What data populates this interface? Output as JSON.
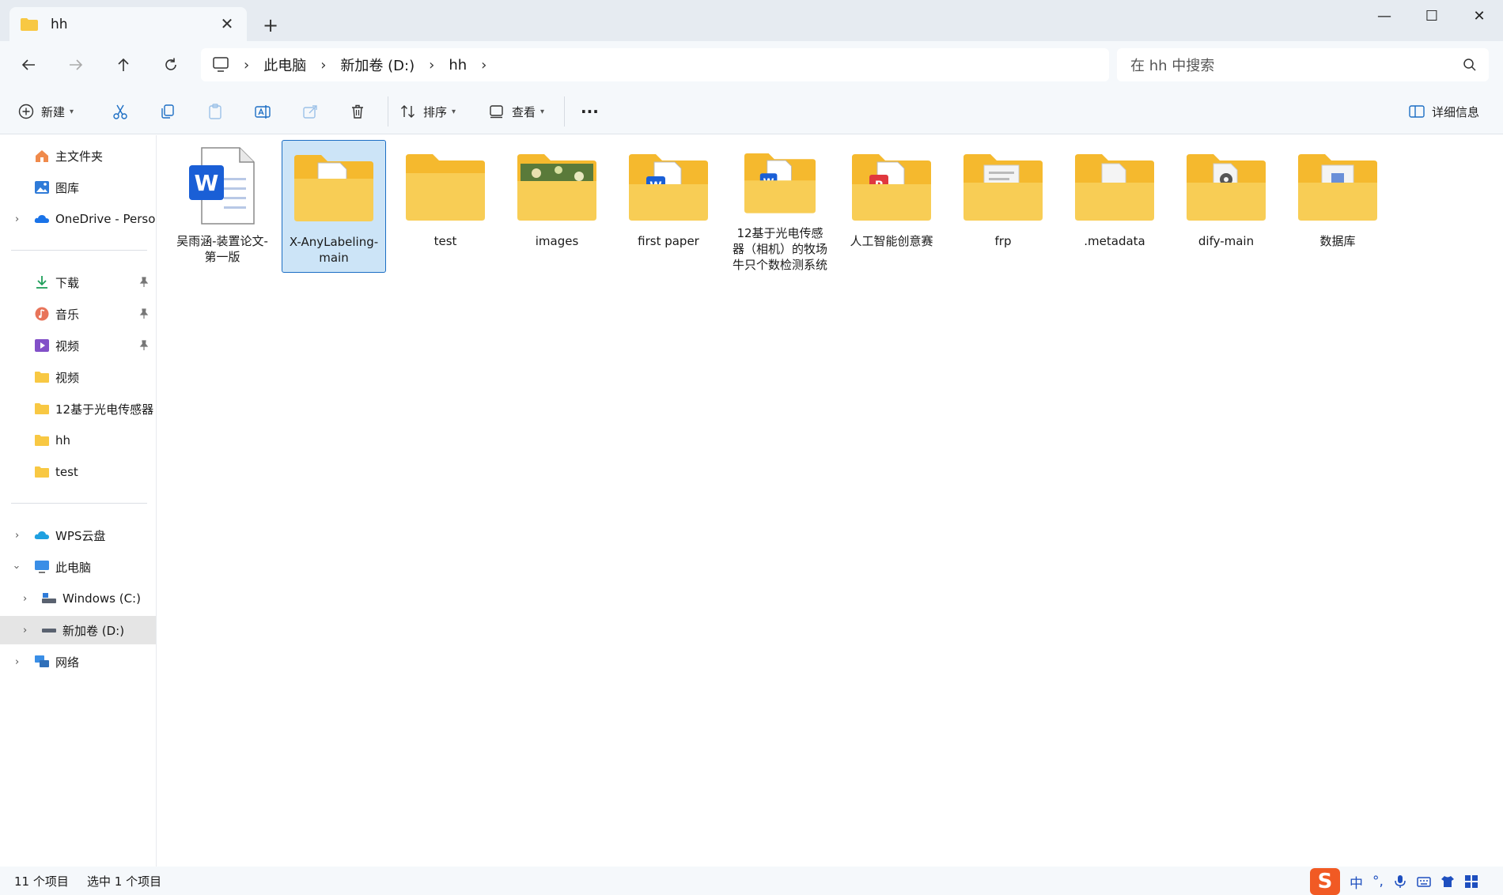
{
  "tab": {
    "title": "hh",
    "close": "✕",
    "new": "+"
  },
  "window": {
    "minimize": "—",
    "maximize": "☐",
    "close": "✕"
  },
  "breadcrumb": [
    "此电脑",
    "新加卷 (D:)",
    "hh"
  ],
  "search": {
    "placeholder": "在 hh 中搜索"
  },
  "toolbar": {
    "new_label": "新建",
    "sort_label": "排序",
    "view_label": "查看",
    "more_label": "···",
    "details_label": "详细信息"
  },
  "sidebar": {
    "quick": [
      {
        "label": "主文件夹",
        "icon": "home-icon"
      },
      {
        "label": "图库",
        "icon": "gallery-icon"
      },
      {
        "label": "OneDrive - Persona",
        "icon": "onedrive-icon"
      }
    ],
    "pinned": [
      {
        "label": "下载",
        "icon": "download-icon"
      },
      {
        "label": "音乐",
        "icon": "music-icon"
      },
      {
        "label": "视频",
        "icon": "video-icon"
      },
      {
        "label": "视频",
        "icon": "folder-icon"
      },
      {
        "label": "12基于光电传感器",
        "icon": "folder-icon"
      },
      {
        "label": "hh",
        "icon": "folder-icon"
      },
      {
        "label": "test",
        "icon": "folder-icon"
      }
    ],
    "devices": [
      {
        "label": "WPS云盘",
        "icon": "wps-cloud-icon"
      },
      {
        "label": "此电脑",
        "icon": "pc-icon"
      },
      {
        "label": "Windows (C:)",
        "icon": "drive-icon"
      },
      {
        "label": "新加卷 (D:)",
        "icon": "drive-icon"
      },
      {
        "label": "网络",
        "icon": "network-icon"
      }
    ]
  },
  "items": [
    {
      "name": "吴雨涵-装置论文-第一版",
      "type": "word-doc"
    },
    {
      "name": "X-AnyLabeling-main",
      "type": "folder-doc",
      "selected": true
    },
    {
      "name": "test",
      "type": "folder"
    },
    {
      "name": "images",
      "type": "folder-image"
    },
    {
      "name": "first paper",
      "type": "folder-word"
    },
    {
      "name": "12基于光电传感器（相机）的牧场牛只个数检测系统",
      "type": "folder-word"
    },
    {
      "name": "人工智能创意赛",
      "type": "folder-pdf"
    },
    {
      "name": "frp",
      "type": "folder-doc"
    },
    {
      "name": ".metadata",
      "type": "folder-doc"
    },
    {
      "name": "dify-main",
      "type": "folder-gear"
    },
    {
      "name": "数据库",
      "type": "folder-db"
    }
  ],
  "status": {
    "count": "11 个项目",
    "selected": "选中 1 个项目"
  },
  "ime": {
    "logo": "S",
    "mode": "中",
    "punct": "°,"
  },
  "colors": {
    "accent": "#1c6ec4",
    "selection": "#cce4f7",
    "folder": "#f8c843",
    "word": "#1a5fd6"
  }
}
